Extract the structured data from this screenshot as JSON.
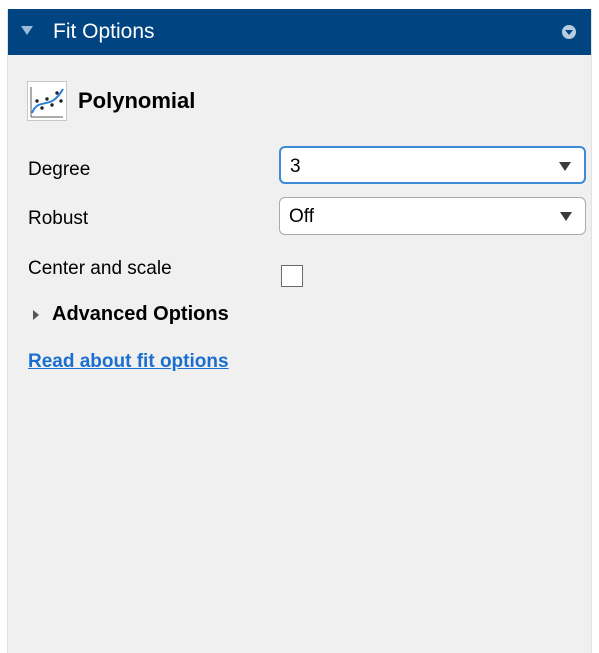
{
  "panel": {
    "title": "Fit Options",
    "collapse_icon": "triangle-down-icon",
    "menu_icon": "circle-chevron-down-icon"
  },
  "fit_type": {
    "name": "Polynomial",
    "icon": "polynomial-fit-icon"
  },
  "options": {
    "degree": {
      "label": "Degree",
      "value": "3"
    },
    "robust": {
      "label": "Robust",
      "value": "Off"
    },
    "center_scale": {
      "label": "Center and scale",
      "checked": false
    }
  },
  "advanced": {
    "label": "Advanced Options",
    "expanded": false
  },
  "help_link": "Read about fit options",
  "colors": {
    "header_bg": "#004481",
    "panel_bg": "#f0f0f0",
    "link": "#1a6fcf",
    "focus_border": "#3d8bd6"
  }
}
